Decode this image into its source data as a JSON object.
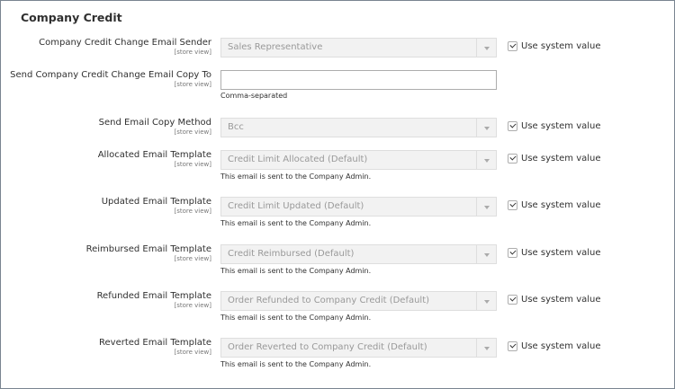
{
  "section_title": "Company Credit",
  "scope_label": "[store view]",
  "use_system_value": "Use system value",
  "fields": [
    {
      "label": "Company Credit Change Email Sender",
      "value": "Sales Representative"
    },
    {
      "label": "Send Company Credit Change Email Copy To",
      "value": "",
      "note": "Comma-separated"
    },
    {
      "label": "Send Email Copy Method",
      "value": "Bcc"
    },
    {
      "label": "Allocated Email Template",
      "value": "Credit Limit Allocated (Default)",
      "note": "This email is sent to the Company Admin."
    },
    {
      "label": "Updated Email Template",
      "value": "Credit Limit Updated (Default)",
      "note": "This email is sent to the Company Admin."
    },
    {
      "label": "Reimbursed Email Template",
      "value": "Credit Reimbursed (Default)",
      "note": "This email is sent to the Company Admin."
    },
    {
      "label": "Refunded Email Template",
      "value": "Order Refunded to Company Credit (Default)",
      "note": "This email is sent to the Company Admin."
    },
    {
      "label": "Reverted Email Template",
      "value": "Order Reverted to Company Credit (Default)",
      "note": "This email is sent to the Company Admin."
    }
  ]
}
